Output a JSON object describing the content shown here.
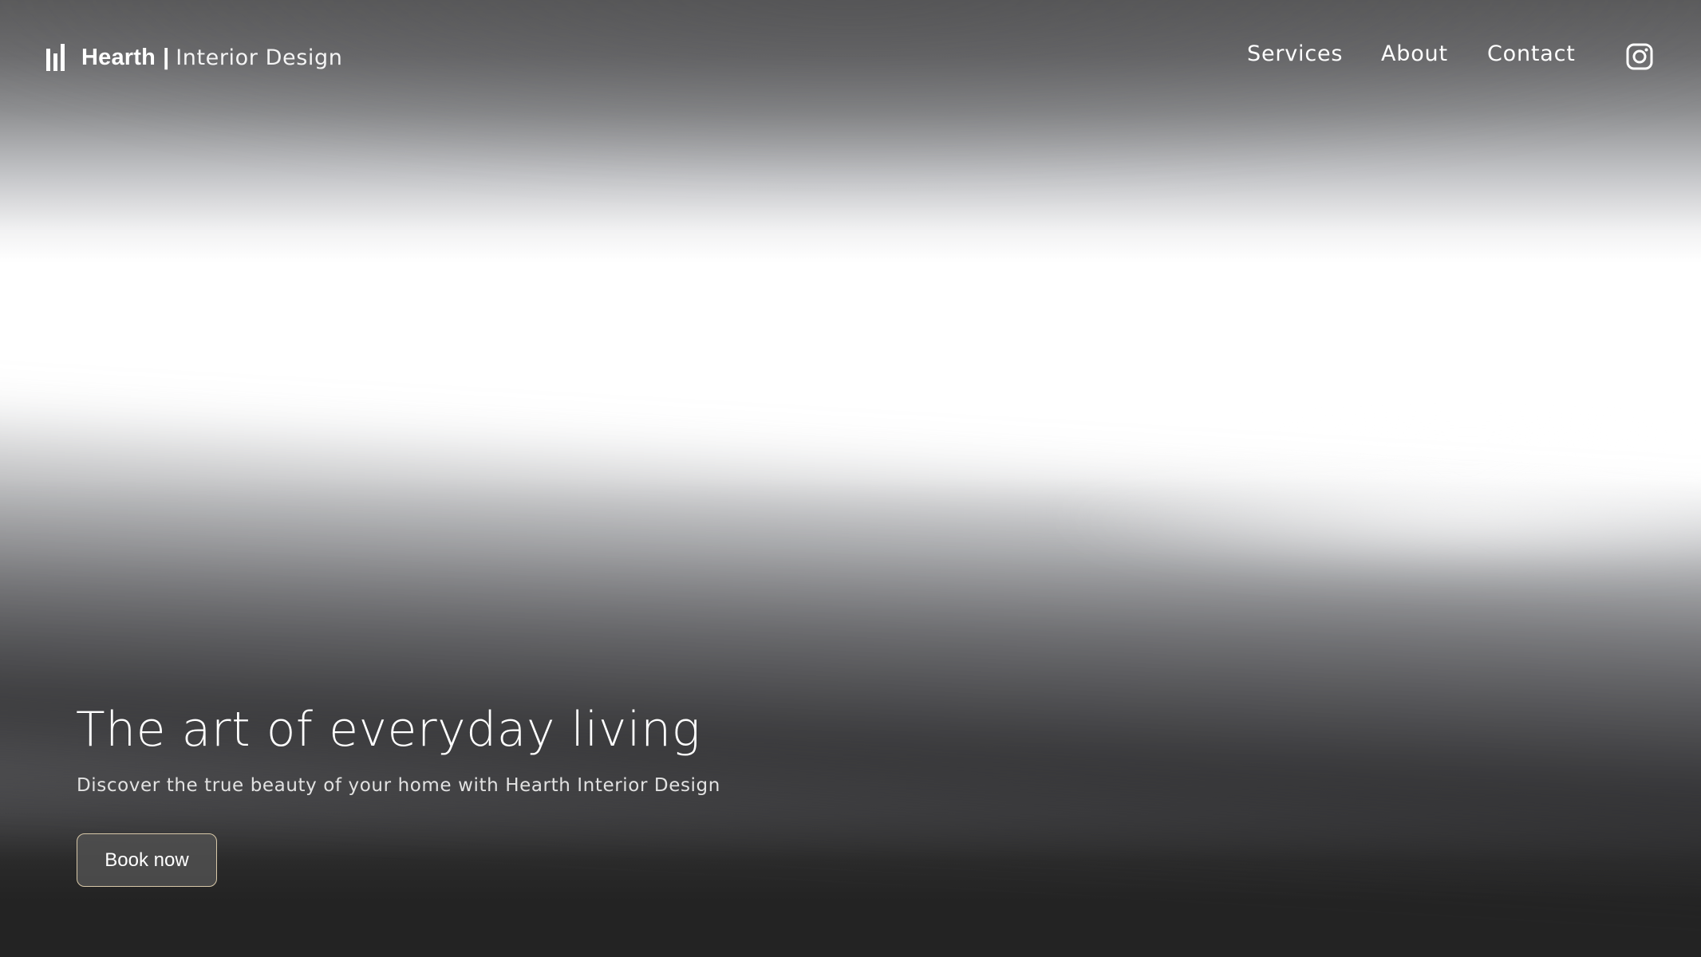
{
  "header": {
    "brand_name": "Hearth",
    "brand_separator": "|",
    "brand_subtitle": "Interior Design",
    "logo_icon": "bar-columns-logo",
    "nav": {
      "services": "Services",
      "about": "About",
      "contact": "Contact"
    },
    "social_icon": "instagram-icon"
  },
  "hero": {
    "title": "The art of everyday living",
    "subtitle": "Discover the true beauty of your home with Hearth Interior Design",
    "cta_label": "Book now"
  },
  "colors": {
    "text": "#ffffff",
    "button_border": "#d8c8a8",
    "button_fill": "#505050",
    "page_bottom": "#232323"
  }
}
